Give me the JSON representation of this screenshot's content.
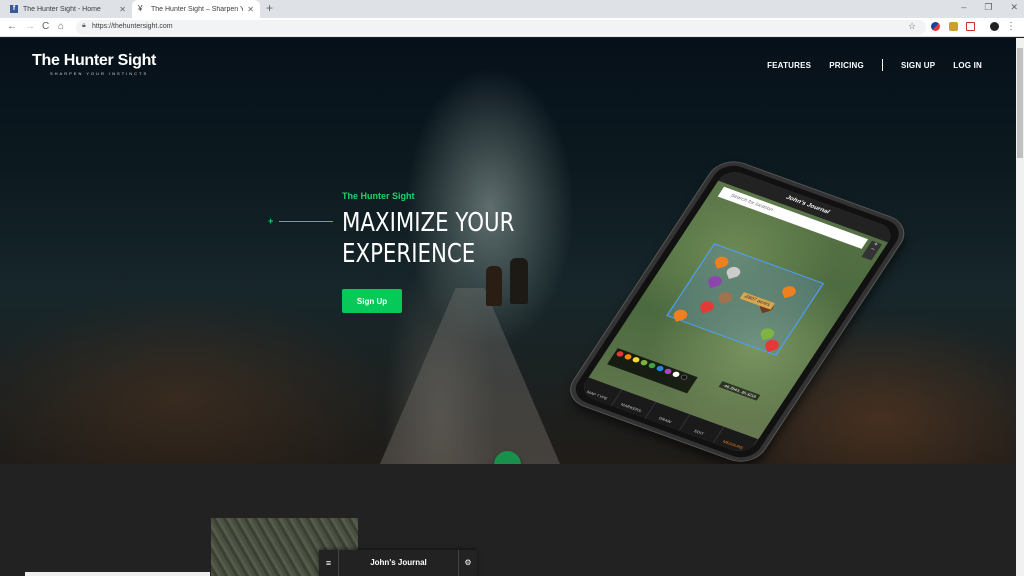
{
  "browser": {
    "tabs": [
      {
        "title": "The Hunter Sight - Home",
        "favicon": "facebook-icon",
        "active": false
      },
      {
        "title": "The Hunter Sight – Sharpen Your",
        "favicon": "deer-icon",
        "active": true
      }
    ],
    "url": "https://thehuntersight.com",
    "controls": {
      "back": "←",
      "forward": "→",
      "reload": "C",
      "home": "⌂",
      "new_tab": "+",
      "minimize": "–",
      "restore": "❐",
      "close": "✕",
      "bookmark": "☆",
      "menu": "⋮"
    }
  },
  "site": {
    "logo": {
      "title": "The Hunter Sight",
      "tagline": "SHARPEN YOUR INSTINCTS"
    },
    "nav": [
      "FEATURES",
      "PRICING",
      "SIGN UP",
      "LOG IN"
    ],
    "hero": {
      "kicker": "The Hunter Sight",
      "headline_line1": "MAXIMIZE YOUR",
      "headline_line2": "EXPERIENCE",
      "cta": "Sign Up"
    },
    "phone": {
      "app_title": "John's Journal",
      "search_placeholder": "Search for location",
      "acres_label": "2807 acres",
      "coords": "-46.3543, 30.3216",
      "tabs": [
        "MAP TYPE",
        "MARKERS",
        "DRAW",
        "EDIT",
        "MEASURE"
      ],
      "active_tab": "MEASURE",
      "palette_colors": [
        "#e53935",
        "#fb8c00",
        "#fdd835",
        "#7cb342",
        "#43a047",
        "#1e88e5",
        "#ab47bc",
        "#ffffff",
        "#111111"
      ]
    },
    "scroll_down": "⌄",
    "journal_bar": {
      "menu": "≡",
      "title": "John's Journal",
      "settings": "⚙"
    }
  },
  "colors": {
    "accent": "#06c95a",
    "kicker": "#1fd16a",
    "measure": "#f07f1e"
  }
}
